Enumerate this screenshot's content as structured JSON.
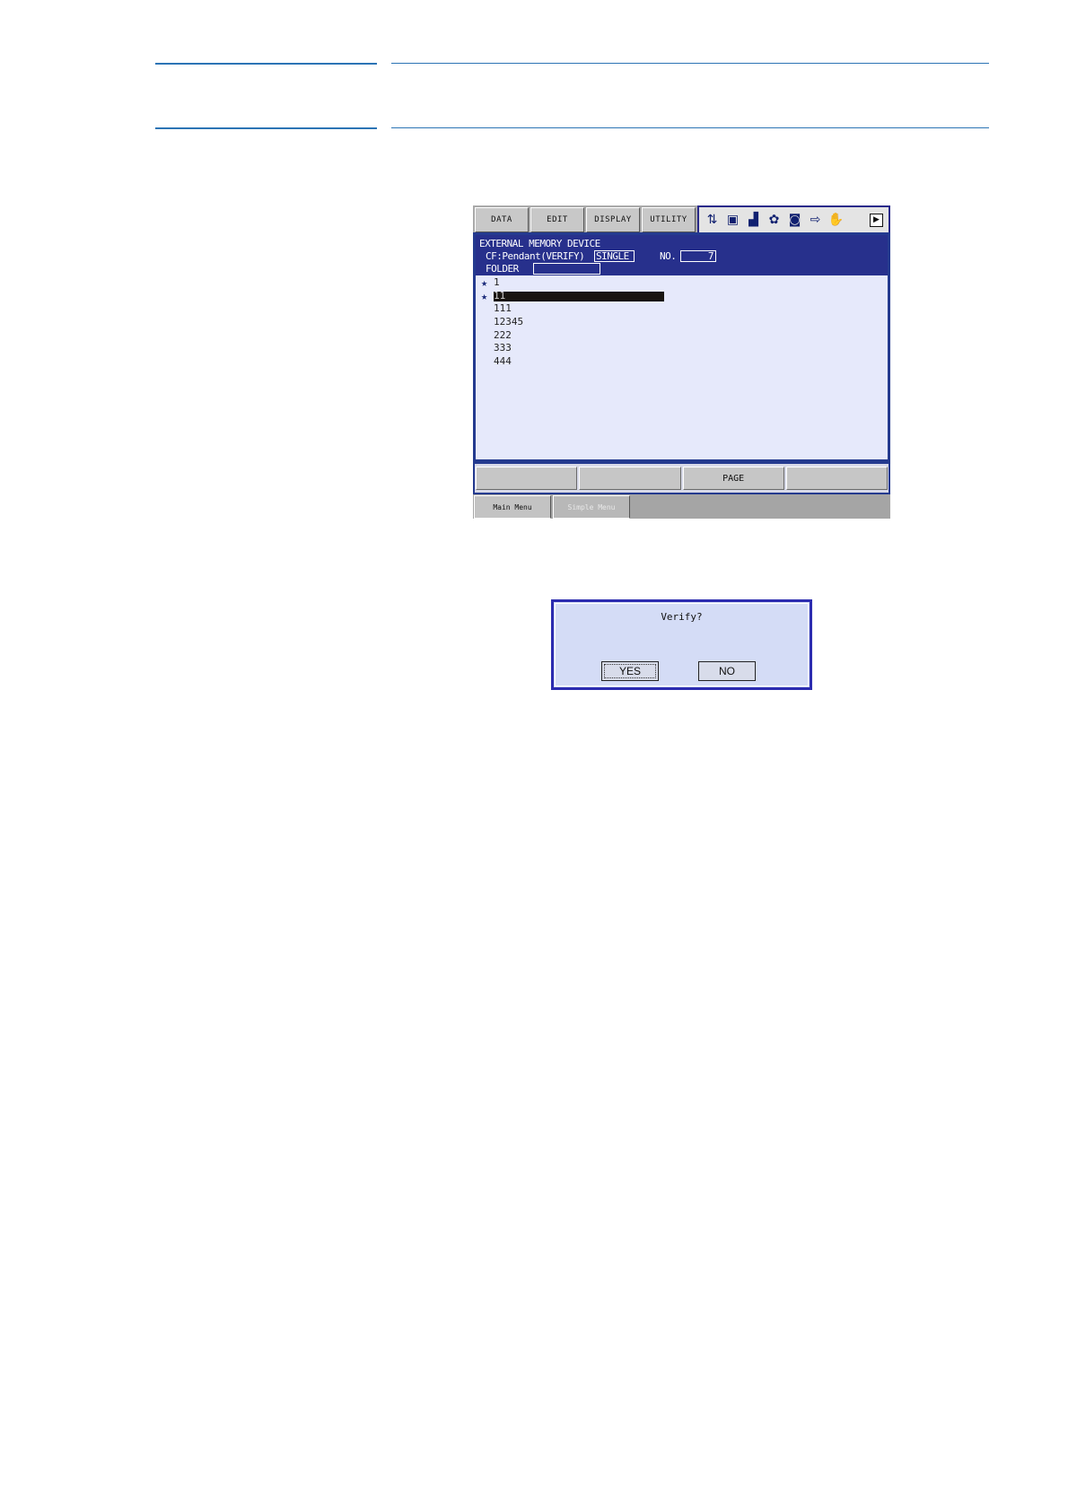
{
  "menu_tabs": [
    "DATA",
    "EDIT",
    "DISPLAY",
    "UTILITY"
  ],
  "status_icons": [
    "teach-mode-icon",
    "job-icon",
    "signal-level-icon",
    "robot-icon",
    "camera-icon",
    "output-icon",
    "hand-icon",
    "next-page-icon"
  ],
  "window": {
    "title": "EXTERNAL MEMORY DEVICE",
    "device_line": "CF:Pendant(VERIFY)",
    "mode_value": "SINGLE",
    "no_label": "NO.",
    "no_value": "7",
    "folder_label": "FOLDER",
    "folder_value": ""
  },
  "files": [
    {
      "star": "★",
      "name": "1",
      "selected": false
    },
    {
      "star": "★",
      "name": "11",
      "selected": true
    },
    {
      "star": "",
      "name": "111",
      "selected": false
    },
    {
      "star": "",
      "name": "12345",
      "selected": false
    },
    {
      "star": "",
      "name": "222",
      "selected": false
    },
    {
      "star": "",
      "name": "333",
      "selected": false
    },
    {
      "star": "",
      "name": "444",
      "selected": false
    }
  ],
  "function_keys": [
    "",
    "",
    "PAGE",
    ""
  ],
  "bottom_tabs": {
    "main_menu": "Main Menu",
    "simple_menu": "Simple Menu"
  },
  "dialog": {
    "message": "Verify?",
    "yes": "YES",
    "no": "NO"
  }
}
